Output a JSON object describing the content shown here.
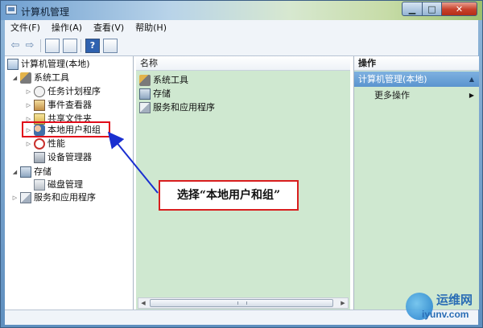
{
  "window": {
    "title": "计算机管理"
  },
  "menu": [
    {
      "label": "文件(F)"
    },
    {
      "label": "操作(A)"
    },
    {
      "label": "查看(V)"
    },
    {
      "label": "帮助(H)"
    }
  ],
  "toolbar": {
    "back_icon": "back-arrow-icon",
    "forward_icon": "forward-arrow-icon",
    "help_label": "?"
  },
  "tree": {
    "root": "计算机管理(本地)",
    "system_tools": "系统工具",
    "task_scheduler": "任务计划程序",
    "event_viewer": "事件查看器",
    "shared_folders": "共享文件夹",
    "local_users": "本地用户和组",
    "performance": "性能",
    "device_manager": "设备管理器",
    "storage": "存储",
    "disk_management": "磁盘管理",
    "services_apps": "服务和应用程序"
  },
  "center": {
    "column_name": "名称",
    "items": [
      "系统工具",
      "存储",
      "服务和应用程序"
    ]
  },
  "actions": {
    "header": "操作",
    "section": "计算机管理(本地)",
    "more": "更多操作"
  },
  "annotation": {
    "callout": "选择“本地用户和组”"
  },
  "watermark": {
    "line1": "运维网",
    "line2": "iyunv.com"
  },
  "colors": {
    "pane_bg": "#cfe8d0",
    "highlight": "#e10b1a",
    "arrow": "#1a2fd0"
  }
}
